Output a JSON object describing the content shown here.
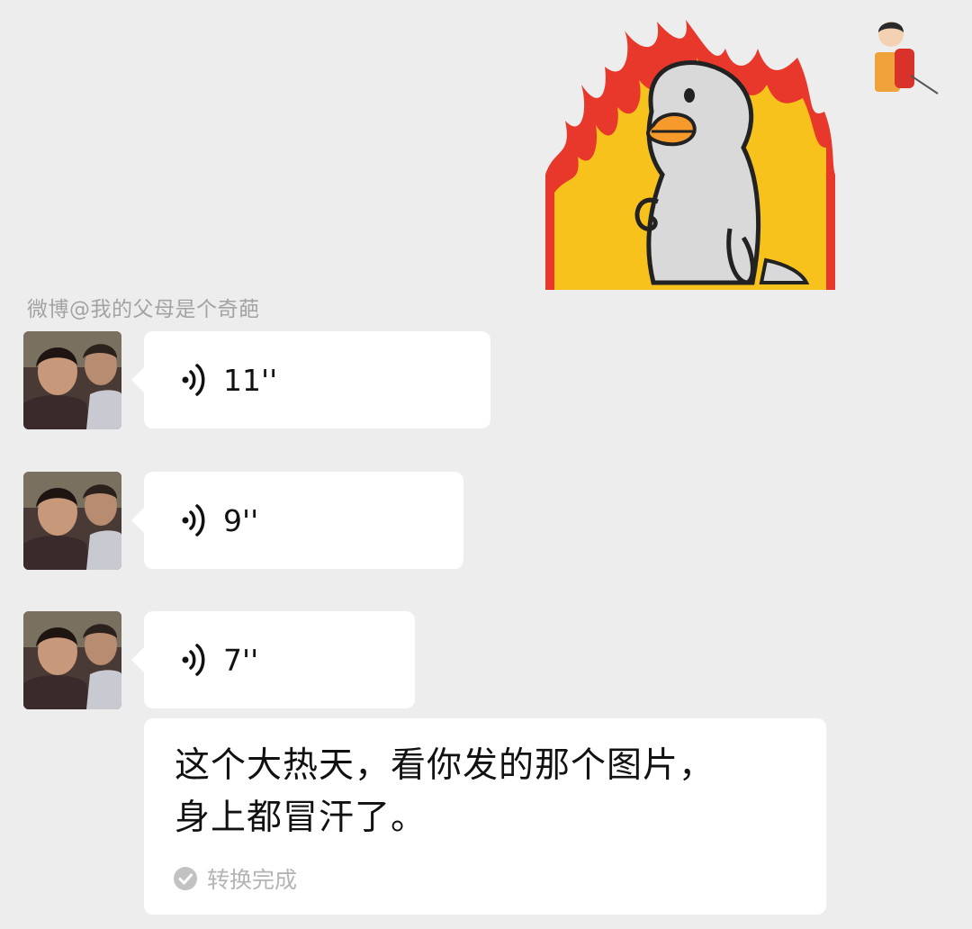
{
  "watermark": "微博@我的父母是个奇葩",
  "messages": {
    "sticker": {
      "description_icon": "duck-on-fire-sticker"
    },
    "voice": [
      {
        "duration": "11''"
      },
      {
        "duration": "9''"
      },
      {
        "duration": "7''"
      }
    ],
    "transcript": {
      "line1": "这个大热天，看你发的那个图片，",
      "line2": "身上都冒汗了。",
      "status": "转换完成"
    }
  },
  "colors": {
    "background": "#ededed",
    "bubble": "#ffffff",
    "fire_red": "#e8382c",
    "fire_yellow": "#f7c21b",
    "duck": "#d9d9d9",
    "beak": "#f59a2b"
  }
}
